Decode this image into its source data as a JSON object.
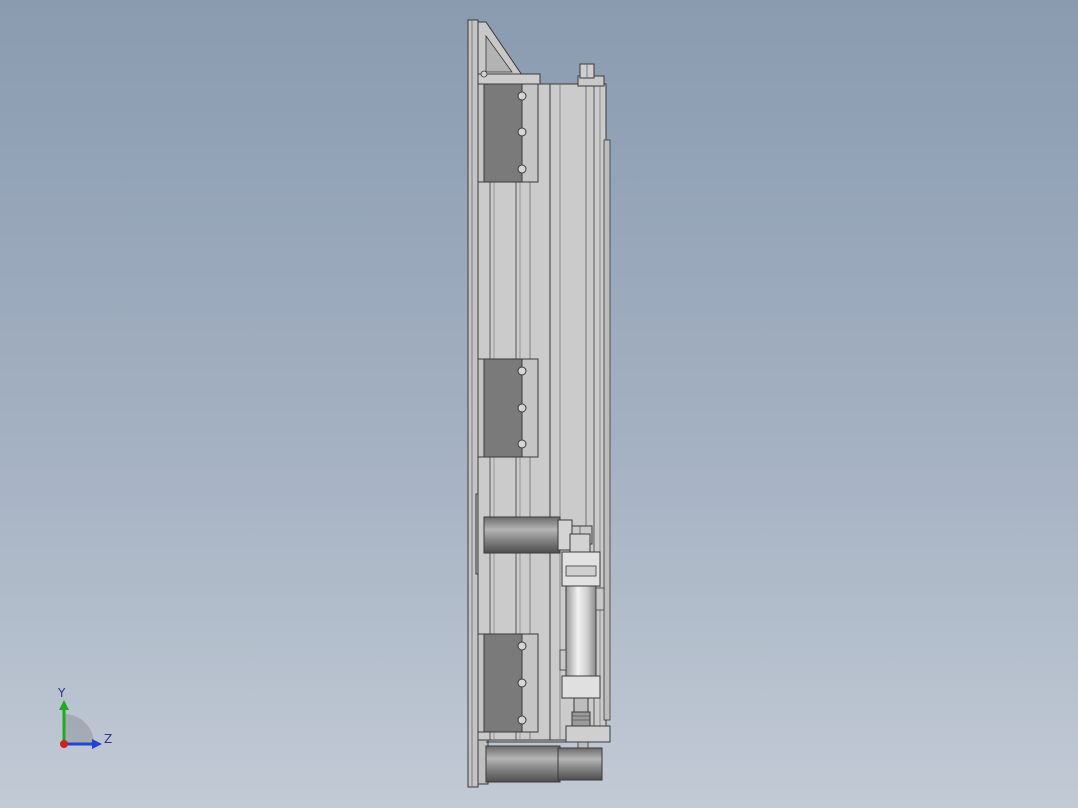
{
  "viewport": {
    "background_top": "#8a9bb0",
    "background_bottom": "#c2cad5"
  },
  "model": {
    "body_color": "#c9c9c9",
    "dark_block_color": "#7a7a7a",
    "outline_color": "#3a3a3a"
  },
  "triad": {
    "y_label": "Y",
    "z_label": "Z",
    "y_color": "#22aa22",
    "z_color": "#2244cc",
    "x_color": "#cc2222"
  }
}
